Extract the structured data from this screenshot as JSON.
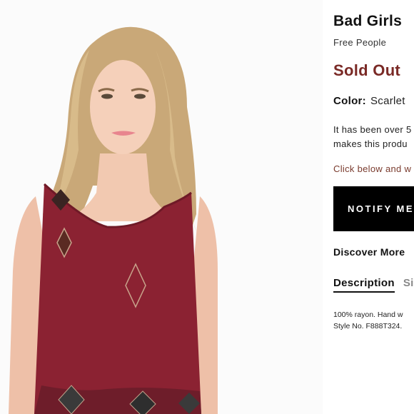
{
  "product": {
    "title": "Bad Girls",
    "brand": "Free People",
    "status": "Sold Out",
    "color_label": "Color:",
    "color_value": "Scarlet",
    "notice_line1": "It has been over 5",
    "notice_line2": "makes this produ",
    "cta_text": "Click below and w",
    "notify_button": "NOTIFY ME",
    "discover": "Discover More",
    "tabs": [
      {
        "label": "Description",
        "active": true
      },
      {
        "label": "Si",
        "active": false
      }
    ],
    "description_line1": "100% rayon. Hand w",
    "description_line2": "Style No. F888T324."
  },
  "colors": {
    "sold_out": "#7a2a26",
    "button_bg": "#000000",
    "garment": "#8b2232"
  }
}
